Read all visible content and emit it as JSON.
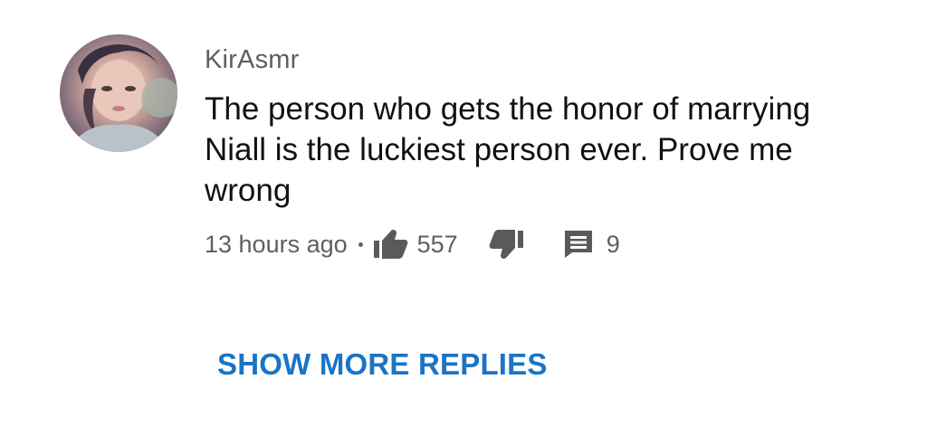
{
  "comment": {
    "author": "KirAsmr",
    "text": "The person who gets the honor of marrying Niall is the luckiest person ever. Prove me wrong",
    "timestamp": "13 hours ago",
    "like_count": "557",
    "reply_count": "9",
    "icons": {
      "like": "thumbs-up-icon",
      "dislike": "thumbs-down-icon",
      "reply": "comment-icon"
    }
  },
  "actions": {
    "show_more_replies": "SHOW MORE REPLIES"
  },
  "colors": {
    "link": "#1b74c5",
    "meta_text": "#5f5f5f",
    "body_text": "#111111",
    "icon": "#5a5a5a"
  }
}
